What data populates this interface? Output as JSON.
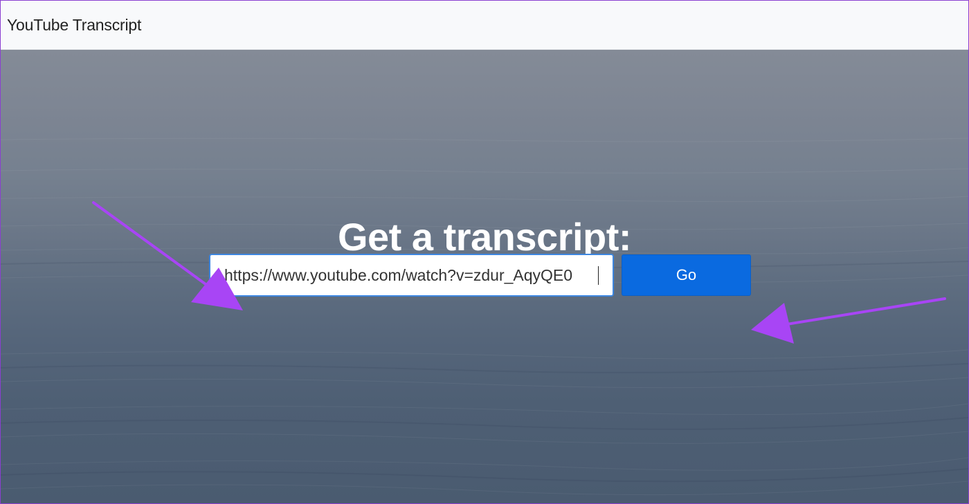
{
  "navbar": {
    "brand": "YouTube Transcript"
  },
  "hero": {
    "title": "Get a transcript:"
  },
  "form": {
    "url_value": "https://www.youtube.com/watch?v=zdur_AqyQE0",
    "go_label": "Go"
  },
  "colors": {
    "accent": "#0a6ae0",
    "annotation_arrow": "#a845f5",
    "navbar_bg": "#f8f9fb"
  }
}
